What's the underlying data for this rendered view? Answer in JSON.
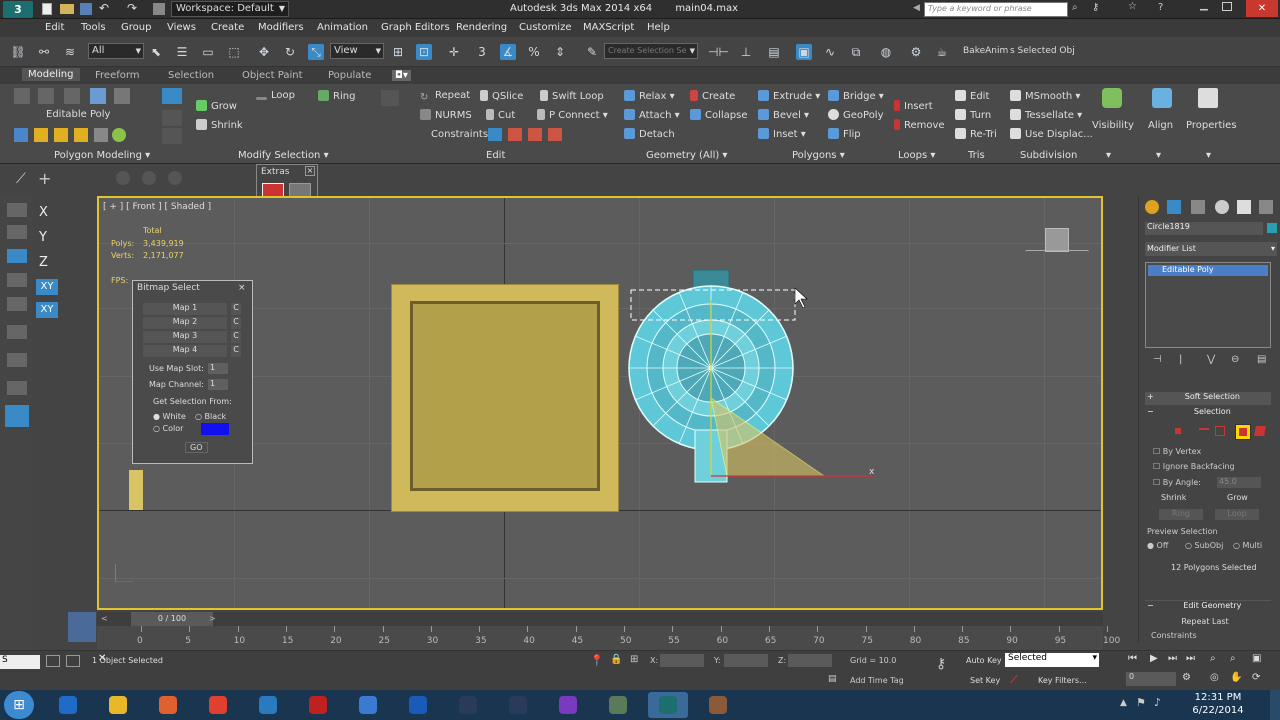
{
  "title": {
    "workspace": "Workspace: Default",
    "app": "Autodesk 3ds Max 2014 x64",
    "file": "main04.max",
    "search_placeholder": "Type a keyword or phrase"
  },
  "menu": [
    "Edit",
    "Tools",
    "Group",
    "Views",
    "Create",
    "Modifiers",
    "Animation",
    "Graph Editors",
    "Rendering",
    "Customize",
    "MAXScript",
    "Help"
  ],
  "toolbar": {
    "filter": "All",
    "view": "View",
    "selection_set": "Create Selection Se",
    "bakeanim": "BakeAnim",
    "selected_obj": "s Selected Obj"
  },
  "ribbon_tabs": [
    "Modeling",
    "Freeform",
    "Selection",
    "Object Paint",
    "Populate"
  ],
  "ribbon": {
    "editable_poly": "Editable Poly",
    "polygon_modeling": "Polygon Modeling",
    "grow": "Grow",
    "shrink": "Shrink",
    "loop": "Loop",
    "ring": "Ring",
    "modify_selection": "Modify Selection",
    "repeat": "Repeat",
    "qslice": "QSlice",
    "swift_loop": "Swift Loop",
    "nurms": "NURMS",
    "cut": "Cut",
    "p_connect": "P Connect",
    "constraints": "Constraints:",
    "edit_section": "Edit",
    "relax": "Relax",
    "create": "Create",
    "attach": "Attach",
    "collapse": "Collapse",
    "detach": "Detach",
    "geometry_all": "Geometry (All)",
    "extrude": "Extrude",
    "bridge": "Bridge",
    "bevel": "Bevel",
    "geopoly": "GeoPoly",
    "inset": "Inset",
    "flip": "Flip",
    "polygons_section": "Polygons",
    "insert": "Insert",
    "remove": "Remove",
    "loops_section": "Loops",
    "edit_tris": "Edit",
    "turn": "Turn",
    "retri": "Re-Tri",
    "tris_section": "Tris",
    "msmooth": "MSmooth",
    "tessellate": "Tessellate",
    "use_displac": "Use Displac...",
    "subdivision_section": "Subdivision",
    "visibility": "Visibility",
    "align": "Align",
    "properties": "Properties"
  },
  "extras": {
    "title": "Extras"
  },
  "viewport": {
    "label": "[ + ] [ Front ] [ Shaded ]",
    "total": "Total",
    "polys_label": "Polys:",
    "polys": "3,439,919",
    "verts_label": "Verts:",
    "verts": "2,171,077",
    "fps_label": "FPS:"
  },
  "axes": [
    "X",
    "Y",
    "Z",
    "XY",
    "XY"
  ],
  "bitmap_select": {
    "title": "Bitmap Select",
    "maps": [
      "Map 1",
      "Map 2",
      "Map 3",
      "Map 4"
    ],
    "clear": "C",
    "use_map_slot": "Use Map Slot:",
    "map_slot_value": "1",
    "map_channel": "Map Channel:",
    "map_channel_value": "1",
    "get_selection_from": "Get Selection From:",
    "white": "White",
    "black": "Black",
    "color": "Color",
    "swatch": "#1010f0",
    "go": "GO"
  },
  "cmdpanel": {
    "object_name": "Circle1819",
    "modifier_list": "Modifier List",
    "stack_item": "Editable Poly",
    "soft_selection": "Soft Selection",
    "selection": "Selection",
    "by_vertex": "By Vertex",
    "ignore_backfacing": "Ignore Backfacing",
    "by_angle": "By Angle:",
    "by_angle_value": "45.0",
    "shrink": "Shrink",
    "grow": "Grow",
    "ring": "Ring",
    "loop": "Loop",
    "preview_selection": "Preview Selection",
    "off": "Off",
    "subobj": "SubObj",
    "multi": "Multi",
    "selected_count": "12 Polygons Selected",
    "edit_geometry": "Edit Geometry",
    "repeat_last": "Repeat Last",
    "constraints": "Constraints"
  },
  "timeline": {
    "position": "0 / 100",
    "ticks": [
      "0",
      "5",
      "10",
      "15",
      "20",
      "25",
      "30",
      "35",
      "40",
      "45",
      "50",
      "55",
      "60",
      "65",
      "70",
      "75",
      "80",
      "85",
      "90",
      "95",
      "100"
    ]
  },
  "status": {
    "objects_selected": "1 Object Selected",
    "x_label": "X:",
    "y_label": "Y:",
    "z_label": "Z:",
    "grid": "Grid = 10.0",
    "add_time_tag": "Add Time Tag",
    "auto_key": "Auto Key",
    "selected": "Selected",
    "set_key": "Set Key",
    "key_filters": "Key Filters...",
    "frame": "0",
    "maxscript_prefix": "S"
  },
  "taskbar": {
    "time": "12:31 PM",
    "date": "6/22/2014",
    "apps": [
      "ie-icon",
      "folder-icon",
      "media-icon",
      "chrome-icon",
      "app-icon",
      "flash-icon",
      "explorer-icon",
      "photoshop-icon",
      "unreal-icon",
      "unreal2-icon",
      "xn-icon",
      "app2-icon",
      "3dsmax-icon",
      "app3-icon"
    ]
  },
  "colors": {
    "accent": "#e0c430",
    "mesh": "#5fc8d8",
    "box": "#d9c465",
    "taskbar": "#1a3550"
  }
}
